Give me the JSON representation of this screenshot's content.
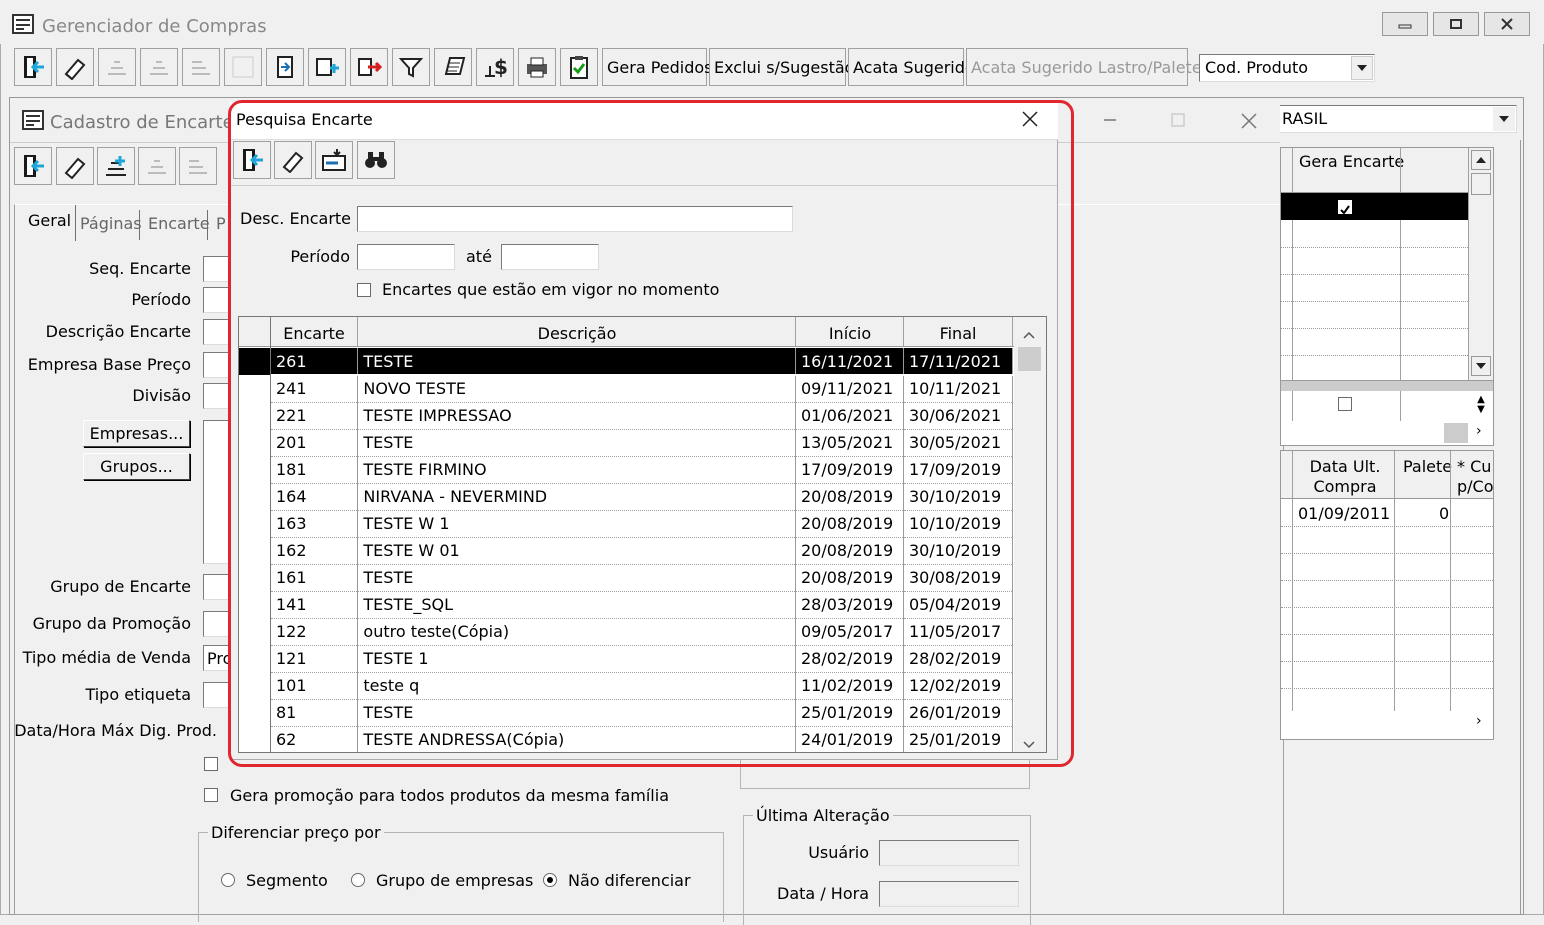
{
  "main_window": {
    "title": "Gerenciador de Compras",
    "toolbar_text_buttons": [
      "Gera Pedidos",
      "Exclui s/Sugestão",
      "Acata Sugerido",
      "Acata Sugerido Lastro/Palete"
    ],
    "combo_value": "Cod. Produto"
  },
  "cadastro": {
    "title": "Cadastro de Encarte",
    "tabs": [
      "Geral",
      "Páginas",
      "Encarte",
      "P"
    ],
    "labels": {
      "seq": "Seq. Encarte",
      "periodo": "Período",
      "descricao": "Descrição Encarte",
      "empresa_base": "Empresa Base Preço",
      "divisao": "Divisão",
      "grupo_encarte": "Grupo de Encarte",
      "grupo_promocao": "Grupo da Promoção",
      "tipo_media": "Tipo média de Venda",
      "tipo_etiqueta": "Tipo etiqueta",
      "data_hora_max": "Data/Hora Máx Dig. Prod."
    },
    "tipo_media_value": "Pro",
    "empresas_button": "Empresas...",
    "grupos_button": "Grupos...",
    "gera_promocao_checkbox": "Gera promoção para todos produtos da mesma família",
    "diferenciar_group": "Diferenciar preço por",
    "radio_options": [
      "Segmento",
      "Grupo de empresas",
      "Não diferenciar"
    ],
    "ultima_alteracao_group": "Última Alteração",
    "usuario_label": "Usuário",
    "data_hora_label": "Data / Hora"
  },
  "right_panel": {
    "combo_value": "RASIL",
    "gera_encarte_header": "Gera Encarte",
    "data_ult_compra_header": "Data Ult.\nCompra",
    "palete_header": "Palete",
    "cu_header": "* Cu\np/Co",
    "row_date": "01/09/2011",
    "row_palete": "0"
  },
  "dialog": {
    "title": "Pesquisa Encarte",
    "desc_label": "Desc. Encarte",
    "periodo_label": "Período",
    "ate_label": "até",
    "vigor_checkbox": "Encartes que estão em vigor no momento",
    "columns": [
      "Encarte",
      "Descrição",
      "Início",
      "Final"
    ],
    "rows": [
      [
        "261",
        "TESTE",
        "16/11/2021",
        "17/11/2021"
      ],
      [
        "241",
        "NOVO TESTE",
        "09/11/2021",
        "10/11/2021"
      ],
      [
        "221",
        "TESTE IMPRESSAO",
        "01/06/2021",
        "30/06/2021"
      ],
      [
        "201",
        "TESTE",
        "13/05/2021",
        "30/05/2021"
      ],
      [
        "181",
        "TESTE FIRMINO",
        "17/09/2019",
        "17/09/2019"
      ],
      [
        "164",
        "NIRVANA - NEVERMIND",
        "20/08/2019",
        "30/10/2019"
      ],
      [
        "163",
        "TESTE W 1",
        "20/08/2019",
        "10/10/2019"
      ],
      [
        "162",
        "TESTE W 01",
        "20/08/2019",
        "30/10/2019"
      ],
      [
        "161",
        "TESTE",
        "20/08/2019",
        "30/08/2019"
      ],
      [
        "141",
        "TESTE_SQL",
        "28/03/2019",
        "05/04/2019"
      ],
      [
        "122",
        "outro teste(Cópia)",
        "09/05/2017",
        "11/05/2017"
      ],
      [
        "121",
        "TESTE 1",
        "28/02/2019",
        "28/02/2019"
      ],
      [
        "101",
        "teste q",
        "11/02/2019",
        "12/02/2019"
      ],
      [
        "81",
        "TESTE",
        "25/01/2019",
        "26/01/2019"
      ],
      [
        "62",
        "TESTE ANDRESSA(Cópia)",
        "24/01/2019",
        "25/01/2019"
      ]
    ]
  },
  "colors": {
    "highlight_frame": "#e0262f",
    "selection": "#000000"
  }
}
